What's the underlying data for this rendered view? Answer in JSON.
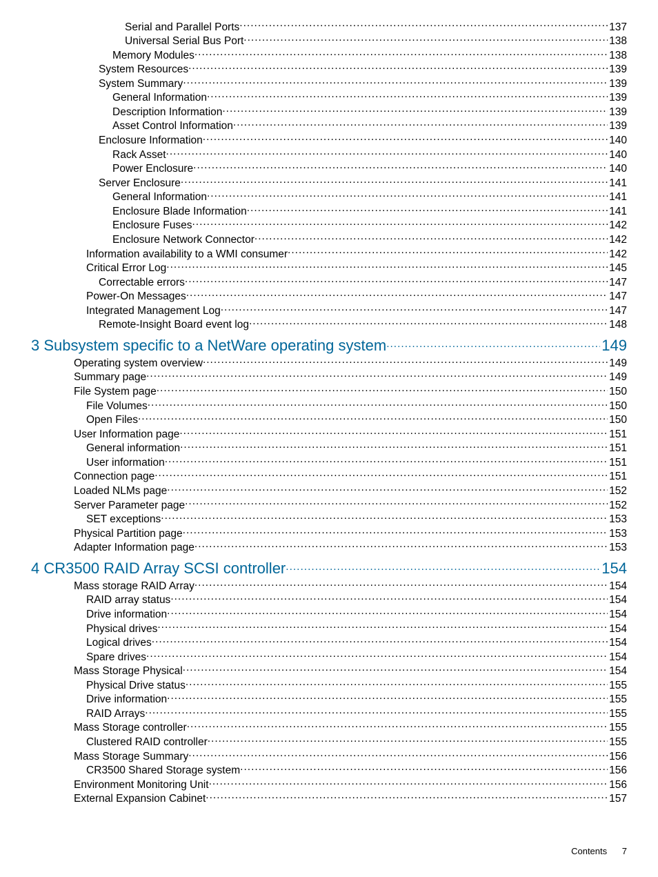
{
  "footer": {
    "label": "Contents",
    "page": "7"
  },
  "toc": [
    {
      "indent": 5,
      "title": "Serial and Parallel Ports",
      "page": "137"
    },
    {
      "indent": 5,
      "title": "Universal Serial Bus Port",
      "page": "138"
    },
    {
      "indent": 4,
      "title": "Memory Modules",
      "page": "138"
    },
    {
      "indent": 3,
      "title": "System Resources",
      "page": "139"
    },
    {
      "indent": 3,
      "title": "System Summary",
      "page": "139"
    },
    {
      "indent": 4,
      "title": "General Information",
      "page": "139"
    },
    {
      "indent": 4,
      "title": "Description Information",
      "page": "139"
    },
    {
      "indent": 4,
      "title": "Asset Control Information",
      "page": "139"
    },
    {
      "indent": 3,
      "title": "Enclosure Information",
      "page": "140"
    },
    {
      "indent": 4,
      "title": "Rack Asset",
      "page": "140"
    },
    {
      "indent": 4,
      "title": "Power Enclosure",
      "page": "140"
    },
    {
      "indent": 3,
      "title": "Server Enclosure",
      "page": "141"
    },
    {
      "indent": 4,
      "title": "General Information",
      "page": "141"
    },
    {
      "indent": 4,
      "title": "Enclosure Blade Information",
      "page": "141"
    },
    {
      "indent": 4,
      "title": "Enclosure Fuses",
      "page": "142"
    },
    {
      "indent": 4,
      "title": "Enclosure Network Connector",
      "page": "142"
    },
    {
      "indent": 2,
      "title": "Information availability to a WMI consumer",
      "page": "142"
    },
    {
      "indent": 2,
      "title": "Critical Error Log",
      "page": "145"
    },
    {
      "indent": 3,
      "title": "Correctable errors",
      "page": "147"
    },
    {
      "indent": 2,
      "title": "Power-On Messages",
      "page": "147"
    },
    {
      "indent": 2,
      "title": "Integrated Management Log",
      "page": "147"
    },
    {
      "indent": 3,
      "title": "Remote-Insight Board event log",
      "page": "148"
    },
    {
      "indent": 0,
      "heading": true,
      "title": "3 Subsystem specific to a NetWare operating system",
      "page": "149"
    },
    {
      "indent": 1,
      "title": "Operating system overview",
      "page": "149"
    },
    {
      "indent": 1,
      "title": "Summary page",
      "page": "149"
    },
    {
      "indent": 1,
      "title": "File System page",
      "page": "150"
    },
    {
      "indent": 2,
      "title": "File Volumes",
      "page": "150"
    },
    {
      "indent": 2,
      "title": "Open Files",
      "page": "150"
    },
    {
      "indent": 1,
      "title": "User Information page",
      "page": "151"
    },
    {
      "indent": 2,
      "title": "General information",
      "page": "151"
    },
    {
      "indent": 2,
      "title": "User information",
      "page": "151"
    },
    {
      "indent": 1,
      "title": "Connection page",
      "page": "151"
    },
    {
      "indent": 1,
      "title": "Loaded NLMs page",
      "page": "152"
    },
    {
      "indent": 1,
      "title": "Server Parameter page",
      "page": "152"
    },
    {
      "indent": 2,
      "title": "SET exceptions",
      "page": "153"
    },
    {
      "indent": 1,
      "title": "Physical Partition page",
      "page": "153"
    },
    {
      "indent": 1,
      "title": "Adapter Information page",
      "page": "153"
    },
    {
      "indent": 0,
      "heading": true,
      "title": "4 CR3500 RAID Array SCSI controller",
      "page": "154"
    },
    {
      "indent": 1,
      "title": "Mass storage RAID Array",
      "page": "154"
    },
    {
      "indent": 2,
      "title": "RAID array status",
      "page": "154"
    },
    {
      "indent": 2,
      "title": "Drive information",
      "page": "154"
    },
    {
      "indent": 2,
      "title": "Physical drives ",
      "page": "154"
    },
    {
      "indent": 2,
      "title": "Logical drives",
      "page": "154"
    },
    {
      "indent": 2,
      "title": "Spare drives",
      "page": "154"
    },
    {
      "indent": 1,
      "title": "Mass Storage Physical",
      "page": "154"
    },
    {
      "indent": 2,
      "title": "Physical Drive status",
      "page": "155"
    },
    {
      "indent": 2,
      "title": "Drive information",
      "page": "155"
    },
    {
      "indent": 2,
      "title": "RAID Arrays",
      "page": "155"
    },
    {
      "indent": 1,
      "title": "Mass Storage controller",
      "page": "155"
    },
    {
      "indent": 2,
      "title": "Clustered RAID controller",
      "page": "155"
    },
    {
      "indent": 1,
      "title": "Mass Storage Summary",
      "page": "156"
    },
    {
      "indent": 2,
      "title": "CR3500 Shared Storage system",
      "page": "156"
    },
    {
      "indent": 1,
      "title": "Environment Monitoring Unit",
      "page": "156"
    },
    {
      "indent": 1,
      "title": "External Expansion Cabinet ",
      "page": "157"
    }
  ]
}
